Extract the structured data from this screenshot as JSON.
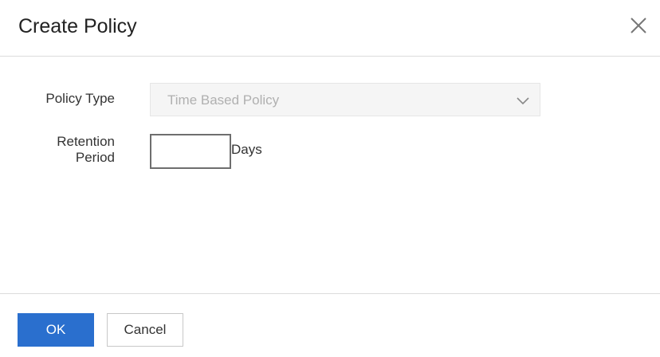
{
  "dialog": {
    "title": "Create Policy"
  },
  "form": {
    "policy_type_label": "Policy Type",
    "policy_type_value": "Time Based Policy",
    "retention_label_line1": "Retention",
    "retention_label_line2": "Period",
    "retention_value": "",
    "retention_unit": "Days"
  },
  "footer": {
    "ok_label": "OK",
    "cancel_label": "Cancel"
  },
  "icons": {
    "close": "close-icon",
    "dropdown": "chevron-down-icon"
  },
  "colors": {
    "primary": "#2a6fce",
    "disabled_text": "#b0b0b0",
    "disabled_bg": "#f5f5f5"
  }
}
